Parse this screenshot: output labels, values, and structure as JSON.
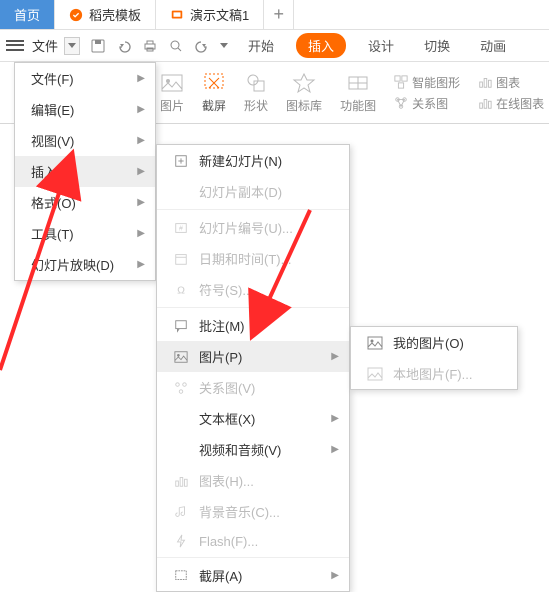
{
  "tabs": {
    "home": "首页",
    "dake": "稻壳模板",
    "pres": "演示文稿1",
    "plus": "+"
  },
  "menubar": {
    "file": "文件",
    "start": "开始",
    "insert": "插入",
    "design": "设计",
    "transition": "切换",
    "anim": "动画"
  },
  "ribbon": {
    "pic": "图片",
    "screenshot": "截屏",
    "shape": "形状",
    "iconlib": "图标库",
    "funcpic": "功能图",
    "smart": "智能图形",
    "chart": "图表",
    "relation": "关系图",
    "onlinechart": "在线图表"
  },
  "menu1": {
    "file": "文件(F)",
    "edit": "编辑(E)",
    "view": "视图(V)",
    "insert": "插入(I)",
    "format": "格式(O)",
    "tools": "工具(T)",
    "slideshow": "幻灯片放映(D)"
  },
  "menu2": {
    "newslide": "新建幻灯片(N)",
    "duplicate": "幻灯片副本(D)",
    "slidenum": "幻灯片编号(U)...",
    "datetime": "日期和时间(T)...",
    "symbol": "符号(S)...",
    "comment": "批注(M)",
    "picture": "图片(P)",
    "relation": "关系图(V)",
    "textbox": "文本框(X)",
    "media": "视频和音频(V)",
    "chart": "图表(H)...",
    "bgmusic": "背景音乐(C)...",
    "flash": "Flash(F)...",
    "screenshot": "截屏(A)"
  },
  "menu3": {
    "mypic": "我的图片(O)",
    "localpic": "本地图片(F)..."
  }
}
